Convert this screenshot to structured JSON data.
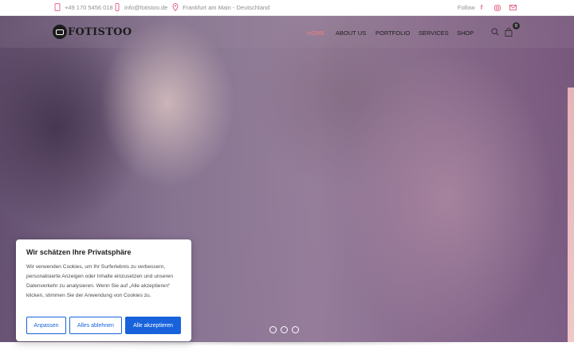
{
  "topbar": {
    "phone": "+49 170 5456 018",
    "email": "info@fotistoo.de",
    "location": "Frankfurt am Main - Deutschland",
    "follow_label": "Follow",
    "social": [
      "facebook-icon",
      "instagram-icon",
      "mail-icon"
    ]
  },
  "brand": {
    "name": "FOTISTOO"
  },
  "nav": {
    "items": [
      {
        "label": "HOME",
        "active": true
      },
      {
        "label": "ABOUT US"
      },
      {
        "label": "PORTFOLIO"
      },
      {
        "label": "SERVICES"
      },
      {
        "label": "SHOP"
      }
    ],
    "cart_count": "0"
  },
  "slider": {
    "slides": 3
  },
  "cookie": {
    "title": "Wir schätzen Ihre Privatsphäre",
    "text": "Wir verwenden Cookies, um Ihr Surferlebnis zu verbessern, personalisierte Anzeigen oder Inhalte einzusetzen und unseren Datenverkehr zu analysieren. Wenn Sie auf „Alle akzeptieren“ klicken, stimmen Sie der Anwendung von Cookies zu.",
    "customize": "Anpassen",
    "reject": "Alles ablehnen",
    "accept": "Alle akzeptieren"
  },
  "colors": {
    "accent": "#e9817f",
    "social": "#e36b8a",
    "cookie_button": "#1863dc"
  }
}
